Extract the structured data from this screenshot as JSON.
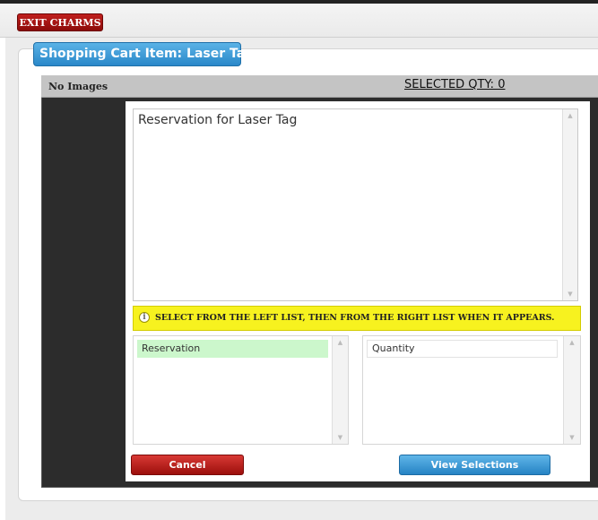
{
  "top_bar": {
    "exit_label": "EXIT CHARMS"
  },
  "panel": {
    "title": "Shopping Cart Item: Laser Tag"
  },
  "header": {
    "no_images_label": "No Images",
    "selected_qty_label": "SELECTED QTY: 0"
  },
  "description": {
    "text": "Reservation for Laser Tag"
  },
  "notice": {
    "icon": "info-icon",
    "text": "SELECT FROM THE LEFT LIST, THEN FROM THE RIGHT LIST WHEN IT APPEARS."
  },
  "left_list": {
    "items": [
      {
        "label": "Reservation",
        "selected": true
      }
    ]
  },
  "right_list": {
    "items": [
      {
        "label": "Quantity"
      }
    ]
  },
  "buttons": {
    "cancel_label": "Cancel",
    "view_label": "View Selections"
  },
  "colors": {
    "exit_button": "#a51412",
    "title_tab": "#3a9bd8",
    "notice_bg": "#f7f21f",
    "selected_item_bg": "#ccf7cc",
    "cancel_button": "#b8201d",
    "view_button": "#3a9bd8"
  }
}
